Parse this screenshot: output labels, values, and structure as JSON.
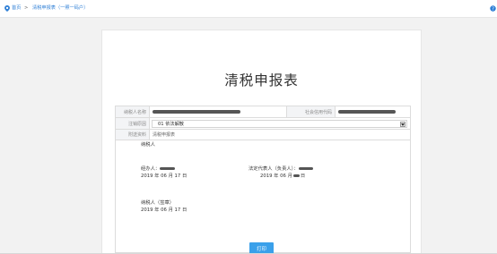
{
  "breadcrumb": {
    "home_label": "首页",
    "separator": ">",
    "current_label": "清税申报表（一照一码户）"
  },
  "icons": {
    "location": "location-pin-icon",
    "help": "help-icon"
  },
  "page": {
    "title": "清税申报表"
  },
  "form": {
    "taxpayer_name_label": "纳税人名称",
    "credit_code_label": "社会信用代码",
    "cancel_reason_label": "注销原因",
    "cancel_reason_value": "01 依法解散",
    "attached_docs_label": "附送资料",
    "attached_docs_value": "清税申报表"
  },
  "statement": {
    "taxpayer_heading": "纳税人",
    "agent_label": "经办人：",
    "agent_date": "2019 年 06 月 17 日",
    "legal_rep_label": "法定代表人（负责人）：",
    "legal_rep_date_prefix": "2019 年 06 月",
    "legal_rep_date_suffix": "日",
    "seal_label": "纳税人（签章）",
    "seal_date": "2019 年 06 月 17 日"
  },
  "actions": {
    "print_label": "打印"
  },
  "colors": {
    "accent": "#2e7fd6",
    "button": "#3aa0ea",
    "label_bg": "#f3f4f6"
  }
}
